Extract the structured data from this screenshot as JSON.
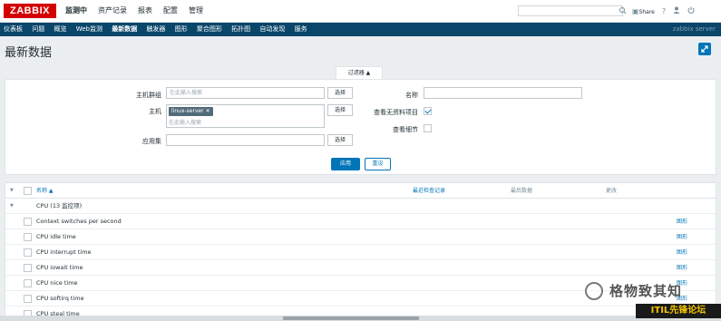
{
  "app": {
    "logo": "ZABBIX"
  },
  "topnav": [
    "监测中",
    "资产记录",
    "报表",
    "配置",
    "管理"
  ],
  "header_icons": {
    "share": "Share",
    "help": "?",
    "user": "user-icon",
    "power": "power-icon"
  },
  "subnav": [
    "仪表板",
    "问题",
    "概览",
    "Web监测",
    "最新数据",
    "触发器",
    "图形",
    "聚合图形",
    "拓扑图",
    "自动发现",
    "服务"
  ],
  "server_name": "zabbix server",
  "page_title": "最新数据",
  "filter": {
    "tab_label": "过滤器 ▲",
    "host_group_label": "主机群组",
    "host_group_placeholder": "在此输入搜索",
    "host_label": "主机",
    "host_tag": "linux-server",
    "host_placeholder": "在此输入搜索",
    "application_label": "应用集",
    "select_label": "选择",
    "name_label": "名称",
    "show_items_without_data_label": "查看无资料项目",
    "show_items_without_data": true,
    "show_details_label": "查看细节",
    "show_details": false,
    "apply_label": "应用",
    "reset_label": "重设"
  },
  "table": {
    "col_name": "名称 ▲",
    "col_last_check": "最近检查记录",
    "col_last_value": "最后数据",
    "col_change": "更改",
    "group": "CPU (13 监控项)",
    "graph_label": "图形",
    "rows": [
      "Context switches per second",
      "CPU idle time",
      "CPU interrupt time",
      "CPU iowait time",
      "CPU nice time",
      "CPU softirq time",
      "CPU steal time"
    ]
  },
  "watermark": {
    "text": "格物致其知",
    "badge": "ITIL先锋论坛"
  }
}
